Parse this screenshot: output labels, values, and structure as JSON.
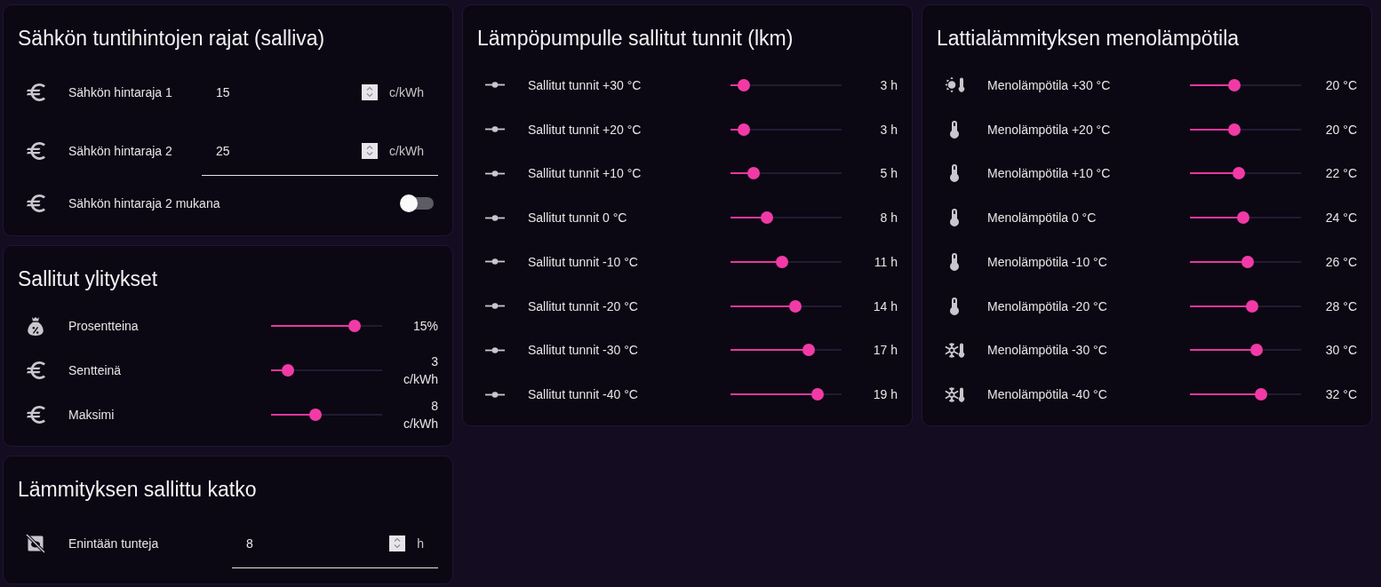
{
  "price_limits": {
    "title": "Sähkön tuntihintojen rajat (salliva)",
    "rows": [
      {
        "kind": "number",
        "label": "Sähkön hintaraja 1",
        "value": "15",
        "unit": "c/kWh",
        "focused": false
      },
      {
        "kind": "number",
        "label": "Sähkön hintaraja 2",
        "value": "25",
        "unit": "c/kWh",
        "focused": true
      },
      {
        "kind": "toggle",
        "label": "Sähkön hintaraja 2 mukana",
        "on": false
      }
    ]
  },
  "allowed_overruns": {
    "title": "Sallitut ylitykset",
    "rows": [
      {
        "kind": "bag",
        "label": "Prosentteina",
        "level": 0.75,
        "reading": "15%"
      },
      {
        "kind": "euro",
        "label": "Sentteinä",
        "level": 0.15,
        "reading": "3 c/kWh"
      },
      {
        "kind": "euro",
        "label": "Maksimi",
        "level": 0.4,
        "reading": "8 c/kWh"
      }
    ]
  },
  "heating_break": {
    "title": "Lämmityksen sallittu katko",
    "rows": [
      {
        "kind": "number",
        "label": "Enintään tunteja",
        "value": "8",
        "unit": "h",
        "focused": true
      }
    ]
  },
  "heat_pump_hours": {
    "title": "Lämpöpumpulle sallitut tunnit (lkm)",
    "rows": [
      {
        "label": "Sallitut tunnit +30 °C",
        "level": 0.12,
        "reading": "3 h"
      },
      {
        "label": "Sallitut tunnit +20 °C",
        "level": 0.12,
        "reading": "3 h"
      },
      {
        "label": "Sallitut tunnit +10 °C",
        "level": 0.21,
        "reading": "5 h"
      },
      {
        "label": "Sallitut tunnit 0 °C",
        "level": 0.33,
        "reading": "8 h"
      },
      {
        "label": "Sallitut tunnit -10 °C",
        "level": 0.46,
        "reading": "11 h"
      },
      {
        "label": "Sallitut tunnit -20 °C",
        "level": 0.58,
        "reading": "14 h"
      },
      {
        "label": "Sallitut tunnit -30 °C",
        "level": 0.7,
        "reading": "17 h"
      },
      {
        "label": "Sallitut tunnit -40 °C",
        "level": 0.78,
        "reading": "19 h"
      }
    ]
  },
  "floor_heating": {
    "title": "Lattialämmityksen menolämpötila",
    "rows": [
      {
        "kind": "sun",
        "label": "Menolämpötila +30 °C",
        "level": 0.4,
        "reading": "20 °C"
      },
      {
        "kind": "thermometer",
        "label": "Menolämpötila +20 °C",
        "level": 0.4,
        "reading": "20 °C"
      },
      {
        "kind": "thermometer",
        "label": "Menolämpötila +10 °C",
        "level": 0.44,
        "reading": "22 °C"
      },
      {
        "kind": "thermometer",
        "label": "Menolämpötila 0 °C",
        "level": 0.48,
        "reading": "24 °C"
      },
      {
        "kind": "thermometer",
        "label": "Menolämpötila -10 °C",
        "level": 0.52,
        "reading": "26 °C"
      },
      {
        "kind": "thermometer",
        "label": "Menolämpötila -20 °C",
        "level": 0.56,
        "reading": "28 °C"
      },
      {
        "kind": "snowflake",
        "label": "Menolämpötila -30 °C",
        "level": 0.6,
        "reading": "30 °C"
      },
      {
        "kind": "snowflake",
        "label": "Menolämpötila -40 °C",
        "level": 0.64,
        "reading": "32 °C"
      }
    ]
  }
}
